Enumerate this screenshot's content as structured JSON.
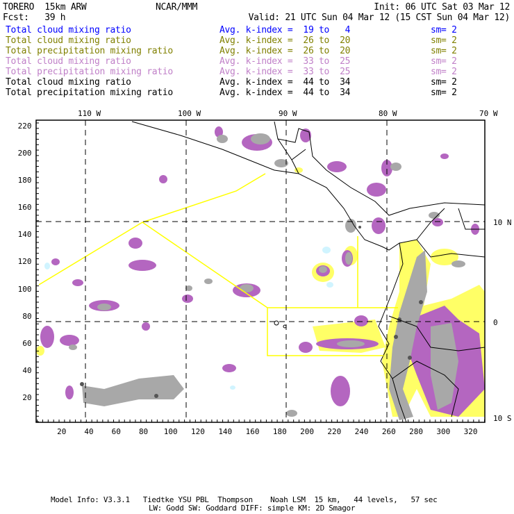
{
  "header": {
    "model": "TORERO  15km ARW",
    "org": "NCAR/MMM",
    "init": "Init: 06 UTC Sat 03 Mar 12",
    "fcst": "Fcst:   39 h",
    "valid": "Valid: 21 UTC Sun 04 Mar 12 (15 CST Sun 04 Mar 12)"
  },
  "legend": [
    {
      "field": "Total cloud mixing ratio",
      "range": "Avg. k-index =  19 to   4",
      "sm": "sm= 2",
      "color": "#0000ff"
    },
    {
      "field": "Total cloud mixing ratio",
      "range": "Avg. k-index =  26 to  20",
      "sm": "sm= 2",
      "color": "#808000"
    },
    {
      "field": "Total precipitation mixing ratio",
      "range": "Avg. k-index =  26 to  20",
      "sm": "sm= 2",
      "color": "#808000"
    },
    {
      "field": "Total cloud mixing ratio",
      "range": "Avg. k-index =  33 to  25",
      "sm": "sm= 2",
      "color": "#c080c8"
    },
    {
      "field": "Total precipitation mixing ratio",
      "range": "Avg. k-index =  33 to  25",
      "sm": "sm= 2",
      "color": "#c080c8"
    },
    {
      "field": "Total cloud mixing ratio",
      "range": "Avg. k-index =  44 to  34",
      "sm": "sm= 2",
      "color": "#000000"
    },
    {
      "field": "Total precipitation mixing ratio",
      "range": "Avg. k-index =  44 to  34",
      "sm": "sm= 2",
      "color": "#000000"
    }
  ],
  "map": {
    "lon_labels": [
      "110 W",
      "100 W",
      "90 W",
      "80 W",
      "70 W"
    ],
    "lat_labels": [
      "10 N",
      "0",
      "10 S"
    ],
    "x_ticks": [
      "20",
      "40",
      "60",
      "80",
      "100",
      "120",
      "140",
      "160",
      "180",
      "200",
      "220",
      "240",
      "260",
      "280",
      "300",
      "320"
    ],
    "y_ticks": [
      "220",
      "200",
      "180",
      "160",
      "140",
      "120",
      "100",
      "80",
      "60",
      "40",
      "20"
    ],
    "colors": {
      "gray": "#a8a8a8",
      "purple": "#b466c0",
      "yellow": "#ffff66",
      "lightblue": "#d0f4ff",
      "box": "#ffff00"
    }
  },
  "footer": {
    "line1": "Model Info: V3.3.1   Tiedtke YSU PBL  Thompson    Noah LSM  15 km,   44 levels,   57 sec",
    "line2": "LW: Godd SW: Goddard DIFF: simple KM: 2D Smagor"
  }
}
